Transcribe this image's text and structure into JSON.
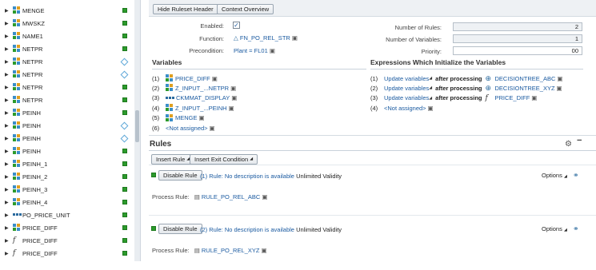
{
  "tree": [
    {
      "label": "MENGE",
      "icon": "structure-icon",
      "status": "active"
    },
    {
      "label": "MWSKZ",
      "icon": "structure-icon",
      "status": "active"
    },
    {
      "label": "NAME1",
      "icon": "structure-icon",
      "status": "active"
    },
    {
      "label": "NETPR",
      "icon": "structure-icon",
      "status": "active"
    },
    {
      "label": "NETPR",
      "icon": "structure-icon",
      "status": "inactive"
    },
    {
      "label": "NETPR",
      "icon": "structure-icon",
      "status": "inactive"
    },
    {
      "label": "NETPR",
      "icon": "structure-icon",
      "status": "active"
    },
    {
      "label": "NETPR",
      "icon": "structure-icon",
      "status": "active"
    },
    {
      "label": "PEINH",
      "icon": "structure-icon",
      "status": "active"
    },
    {
      "label": "PEINH",
      "icon": "structure-icon",
      "status": "inactive"
    },
    {
      "label": "PEINH",
      "icon": "structure-icon",
      "status": "inactive"
    },
    {
      "label": "PEINH",
      "icon": "structure-icon",
      "status": "active"
    },
    {
      "label": "PEINH_1",
      "icon": "structure-icon",
      "status": "active"
    },
    {
      "label": "PEINH_2",
      "icon": "structure-icon",
      "status": "active"
    },
    {
      "label": "PEINH_3",
      "icon": "structure-icon",
      "status": "active"
    },
    {
      "label": "PEINH_4",
      "icon": "structure-icon",
      "status": "active"
    },
    {
      "label": "PO_PRICE_UNIT",
      "icon": "value-list-icon",
      "status": "active"
    },
    {
      "label": "PRICE_DIFF",
      "icon": "structure-icon",
      "status": "active"
    },
    {
      "label": "PRICE_DIFF",
      "icon": "formula-icon",
      "status": "active"
    },
    {
      "label": "PRICE_DIFF",
      "icon": "formula-icon",
      "status": "active"
    }
  ],
  "toolbar": {
    "hide_header": "Hide Ruleset Header",
    "context_overview": "Context Overview"
  },
  "header": {
    "enabled_label": "Enabled:",
    "function_label": "Function:",
    "function_value": "FN_PO_REL_STR",
    "precondition_label": "Precondition:",
    "precondition_value": "Plant = FL01",
    "num_rules_label": "Number of Rules:",
    "num_rules_value": "2",
    "num_vars_label": "Number of Variables:",
    "num_vars_value": "1",
    "priority_label": "Priority:",
    "priority_value": "00"
  },
  "variables": {
    "title": "Variables",
    "items": [
      {
        "num": "(1)",
        "label": "PRICE_DIFF",
        "icon": "structure-icon"
      },
      {
        "num": "(2)",
        "label": "Z_INPUT_...NETPR",
        "icon": "structure-icon"
      },
      {
        "num": "(3)",
        "label": "CKMMAT_DISPLAY",
        "icon": "value-list-icon"
      },
      {
        "num": "(4)",
        "label": "Z_INPUT_...PEINH",
        "icon": "structure-icon"
      },
      {
        "num": "(5)",
        "label": "MENGE",
        "icon": "structure-icon"
      },
      {
        "num": "(6)",
        "label": "<Not assigned>",
        "icon": ""
      }
    ]
  },
  "expressions": {
    "title": "Expressions Which Initialize the Variables",
    "items": [
      {
        "num": "(1)",
        "update": "Update variables",
        "after": "after processing",
        "target": "DECISIONTREE_ABC",
        "icon": "decision-tree-icon"
      },
      {
        "num": "(2)",
        "update": "Update variables",
        "after": "after processing",
        "target": "DECISIONTREE_XYZ",
        "icon": "decision-tree-icon"
      },
      {
        "num": "(3)",
        "update": "Update variables",
        "after": "after processing",
        "target": "PRICE_DIFF",
        "icon": "formula-icon"
      },
      {
        "num": "(4)",
        "update": "",
        "after": "",
        "target": "<Not assigned>",
        "icon": ""
      }
    ]
  },
  "rules": {
    "title": "Rules",
    "insert_rule": "Insert Rule",
    "insert_exit": "Insert Exit Condition",
    "items": [
      {
        "disable": "Disable Rule",
        "desc": "(1) Rule: No description is available",
        "validity": "Unlimited Validity",
        "options": "Options",
        "process_label": "Process Rule:",
        "process_value": "RULE_PO_REL_ABC"
      },
      {
        "disable": "Disable Rule",
        "desc": "(2) Rule: No description is available",
        "validity": "Unlimited Validity",
        "options": "Options",
        "process_label": "Process Rule:",
        "process_value": "RULE_PO_REL_XYZ"
      }
    ]
  }
}
